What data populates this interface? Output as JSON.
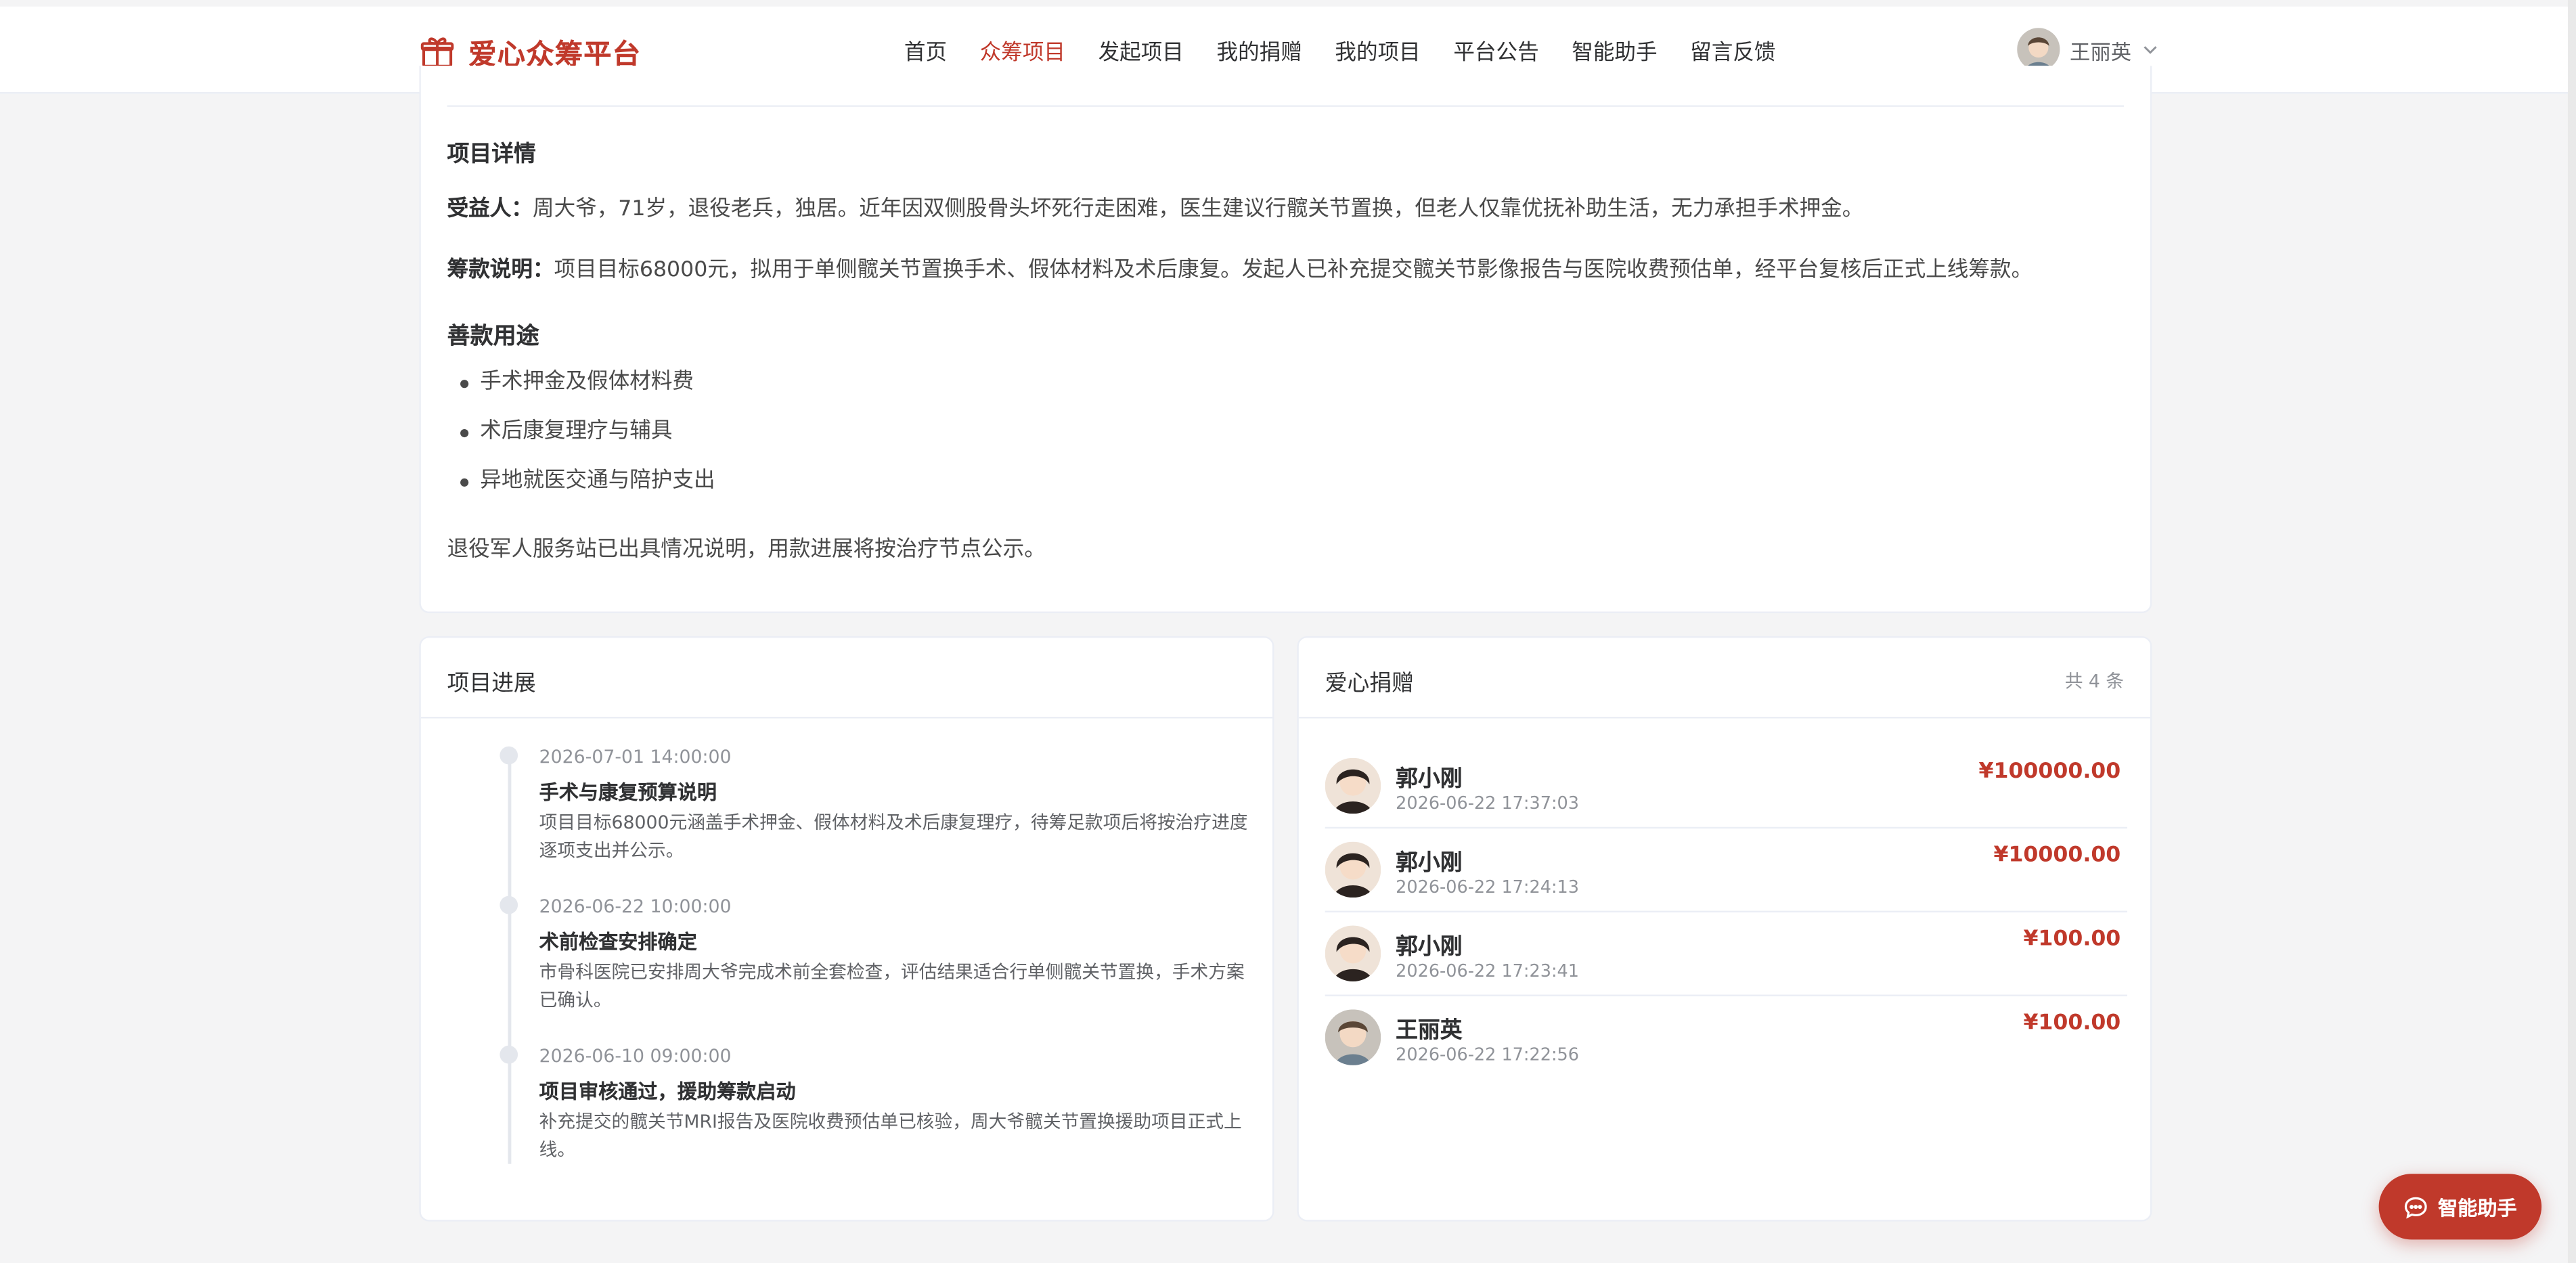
{
  "header": {
    "logo_text": "爱心众筹平台",
    "nav": [
      "首页",
      "众筹项目",
      "发起项目",
      "我的捐赠",
      "我的项目",
      "平台公告",
      "智能助手",
      "留言反馈"
    ],
    "active_nav": "众筹项目",
    "user_name": "王丽英"
  },
  "detail": {
    "section_title": "项目详情",
    "beneficiary_label": "受益人：",
    "beneficiary_text": "周大爷，71岁，退役老兵，独居。近年因双侧股骨头坏死行走困难，医生建议行髋关节置换，但老人仅靠优抚补助生活，无力承担手术押金。",
    "funding_label": "筹款说明：",
    "funding_text": "项目目标68000元，拟用于单侧髋关节置换手术、假体材料及术后康复。发起人已补充提交髋关节影像报告与医院收费预估单，经平台复核后正式上线筹款。",
    "usage_title": "善款用途",
    "usage_items": [
      "手术押金及假体材料费",
      "术后康复理疗与辅具",
      "异地就医交通与陪护支出"
    ],
    "note": "退役军人服务站已出具情况说明，用款进展将按治疗节点公示。"
  },
  "progress": {
    "title": "项目进展",
    "items": [
      {
        "time": "2026-07-01 14:00:00",
        "title": "手术与康复预算说明",
        "desc": "项目目标68000元涵盖手术押金、假体材料及术后康复理疗，待筹足款项后将按治疗进度逐项支出并公示。"
      },
      {
        "time": "2026-06-22 10:00:00",
        "title": "术前检查安排确定",
        "desc": "市骨科医院已安排周大爷完成术前全套检查，评估结果适合行单侧髋关节置换，手术方案已确认。"
      },
      {
        "time": "2026-06-10 09:00:00",
        "title": "项目审核通过，援助筹款启动",
        "desc": "补充提交的髋关节MRI报告及医院收费预估单已核验，周大爷髋关节置换援助项目正式上线。"
      }
    ]
  },
  "donations": {
    "title": "爱心捐赠",
    "count_text": "共 4 条",
    "items": [
      {
        "name": "郭小刚",
        "time": "2026-06-22 17:37:03",
        "amount": "¥100000.00",
        "avatar": "anime-avatar-icon"
      },
      {
        "name": "郭小刚",
        "time": "2026-06-22 17:24:13",
        "amount": "¥10000.00",
        "avatar": "anime-avatar-icon"
      },
      {
        "name": "郭小刚",
        "time": "2026-06-22 17:23:41",
        "amount": "¥100.00",
        "avatar": "anime-avatar-icon"
      },
      {
        "name": "王丽英",
        "time": "2026-06-22 17:22:56",
        "amount": "¥100.00",
        "avatar": "user-avatar-icon"
      }
    ]
  },
  "assistant_button": "智能助手",
  "colors": {
    "brand": "#c0392b",
    "background": "#f4f4f5",
    "card": "#ffffff"
  }
}
